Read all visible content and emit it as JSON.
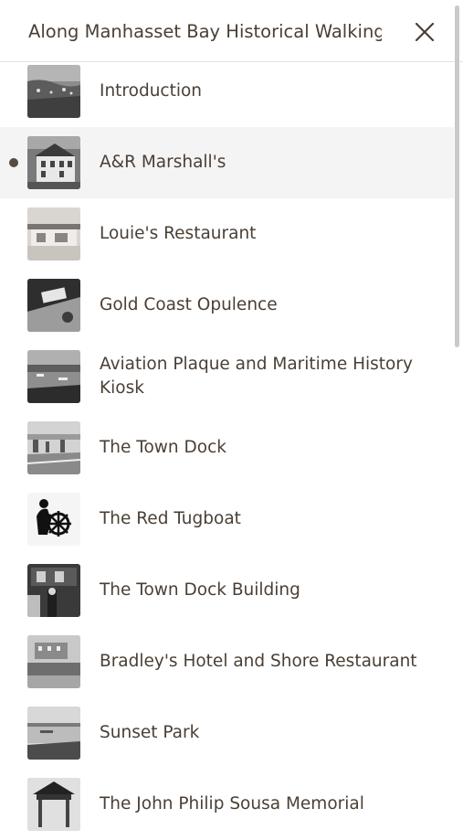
{
  "header": {
    "title": "Along Manhasset Bay Historical Walking"
  },
  "stops": [
    {
      "label": "Introduction",
      "thumb_icon": "aerial-bay-photo"
    },
    {
      "label": "A&R Marshall's",
      "thumb_icon": "white-building-photo",
      "active": true
    },
    {
      "label": "Louie's Restaurant",
      "thumb_icon": "restaurant-photo"
    },
    {
      "label": "Gold Coast Opulence",
      "thumb_icon": "mansion-aerial-photo"
    },
    {
      "label": "Aviation Plaque and Maritime History Kiosk",
      "thumb_icon": "harbor-photo"
    },
    {
      "label": "The Town Dock",
      "thumb_icon": "dock-photo"
    },
    {
      "label": "The Red Tugboat",
      "thumb_icon": "tugboat-captain-icon"
    },
    {
      "label": "The Town Dock Building",
      "thumb_icon": "dock-building-photo"
    },
    {
      "label": "Bradley's Hotel and Shore Restaurant",
      "thumb_icon": "hotel-photo"
    },
    {
      "label": "Sunset Park",
      "thumb_icon": "park-water-photo"
    },
    {
      "label": "The John Philip Sousa Memorial",
      "thumb_icon": "memorial-photo"
    }
  ]
}
